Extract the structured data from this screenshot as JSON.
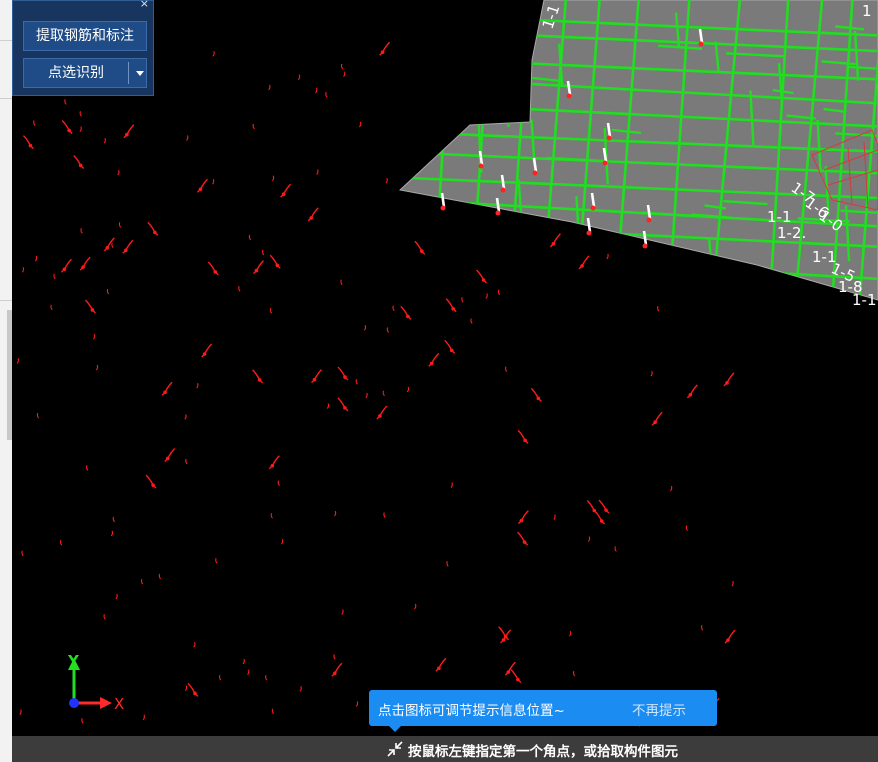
{
  "panel": {
    "close_glyph": "×",
    "extract_button": "提取钢筋和标注",
    "pick_button": "点选识别"
  },
  "tooltip": {
    "message": "点击图标可调节提示信息位置~",
    "dismiss": "不再提示"
  },
  "statusbar": {
    "instruction": "按鼠标左键指定第一个角点，或拾取构件图元"
  },
  "axes": {
    "y_label": "Y",
    "x_label": "X"
  },
  "drawing_labels": [
    "1-1",
    "1",
    "1-2",
    "1-2.",
    "1-7",
    "1-5",
    "1-8",
    "1-0",
    "1-6"
  ],
  "colors": {
    "background": "#000000",
    "floor_fill": "#7a7a7a",
    "beam_lines": "#22dd22",
    "rebar": "#ff0000",
    "panel_bg": "#17355f",
    "tooltip_bg": "#1b8cf2",
    "status_bg": "#3c3c3c"
  }
}
